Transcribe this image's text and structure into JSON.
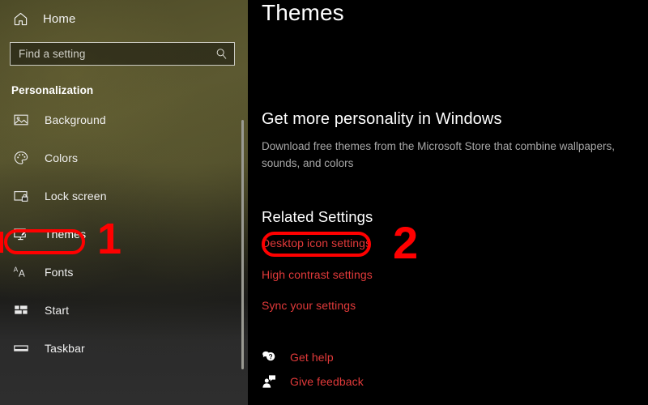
{
  "window": {
    "app": "Settings",
    "accent_red": "#ff0000",
    "link_red": "#e23a3a"
  },
  "sidebar": {
    "home": {
      "label": "Home",
      "icon": "home-icon"
    },
    "search": {
      "placeholder": "Find a setting",
      "value": "",
      "icon": "search-icon"
    },
    "category_heading": "Personalization",
    "items": [
      {
        "label": "Background",
        "icon": "picture-icon",
        "selected": false
      },
      {
        "label": "Colors",
        "icon": "palette-icon",
        "selected": false
      },
      {
        "label": "Lock screen",
        "icon": "lock-screen-icon",
        "selected": false
      },
      {
        "label": "Themes",
        "icon": "themes-icon",
        "selected": true
      },
      {
        "label": "Fonts",
        "icon": "fonts-icon",
        "selected": false
      },
      {
        "label": "Start",
        "icon": "start-icon",
        "selected": false
      },
      {
        "label": "Taskbar",
        "icon": "taskbar-icon",
        "selected": false
      }
    ]
  },
  "main": {
    "page_title": "Themes",
    "promo": {
      "title": "Get more personality in Windows",
      "body": "Download free themes from the Microsoft Store that combine wallpapers, sounds, and colors"
    },
    "related_settings": {
      "heading": "Related Settings",
      "links": [
        {
          "label": "Desktop icon settings"
        },
        {
          "label": "High contrast settings"
        },
        {
          "label": "Sync your settings"
        }
      ]
    },
    "support": [
      {
        "label": "Get help",
        "icon": "help-bubble-icon"
      },
      {
        "label": "Give feedback",
        "icon": "feedback-person-icon"
      }
    ]
  },
  "annotations": {
    "step_1": {
      "number": "1",
      "target": "Themes"
    },
    "step_2": {
      "number": "2",
      "target": "Desktop icon settings"
    }
  }
}
